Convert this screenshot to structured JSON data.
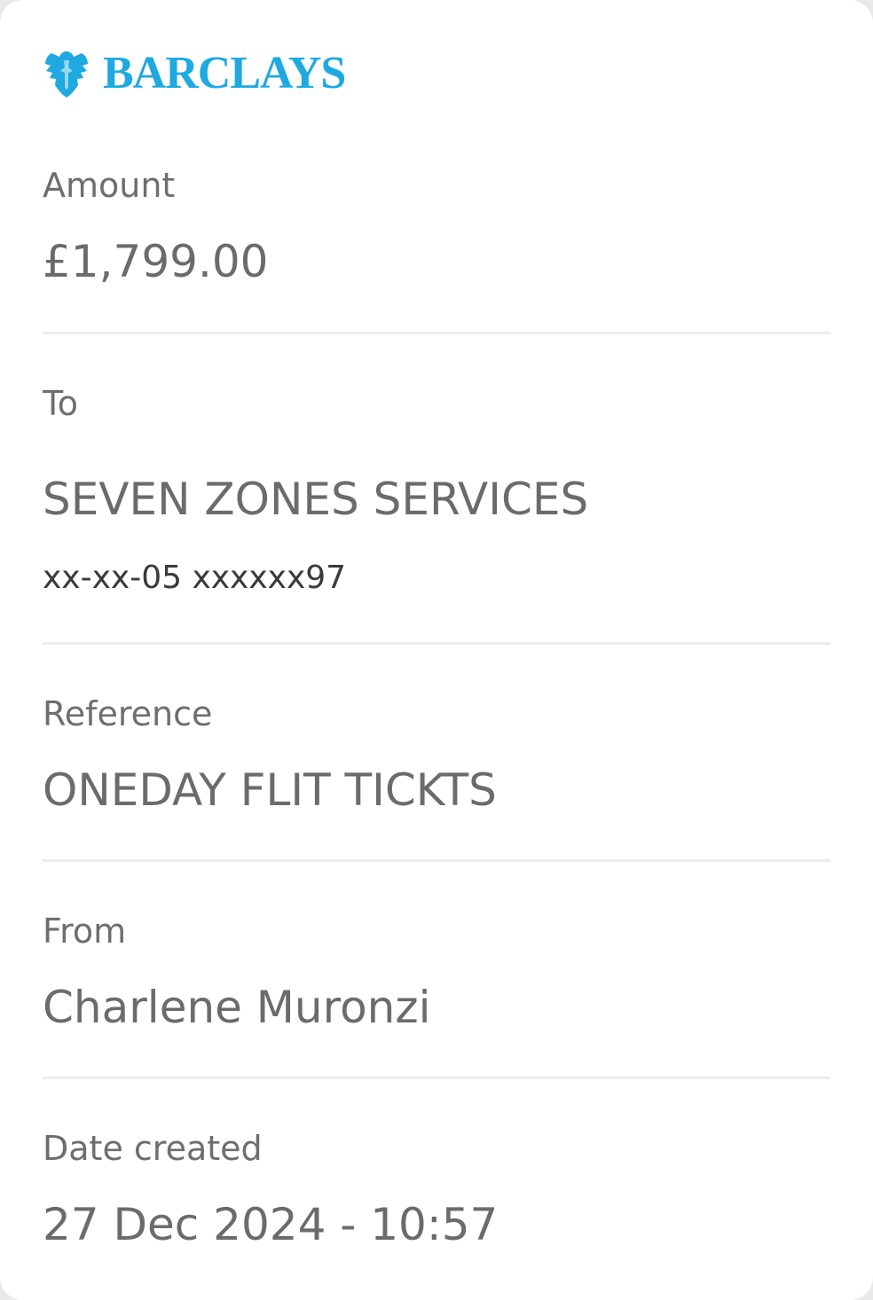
{
  "brand": {
    "name": "BARCLAYS",
    "icon": "eagle-icon",
    "color": "#1ea9e1"
  },
  "amount": {
    "label": "Amount",
    "value": "£1,799.00"
  },
  "recipient": {
    "label": "To",
    "name": "SEVEN ZONES SERVICES",
    "account": "xx-xx-05 xxxxxx97"
  },
  "reference": {
    "label": "Reference",
    "value": "ONEDAY FLIT TICKTS"
  },
  "sender": {
    "label": "From",
    "name": "Charlene Muronzi"
  },
  "date_created": {
    "label": "Date created",
    "value": "27 Dec 2024 - 10:57"
  }
}
